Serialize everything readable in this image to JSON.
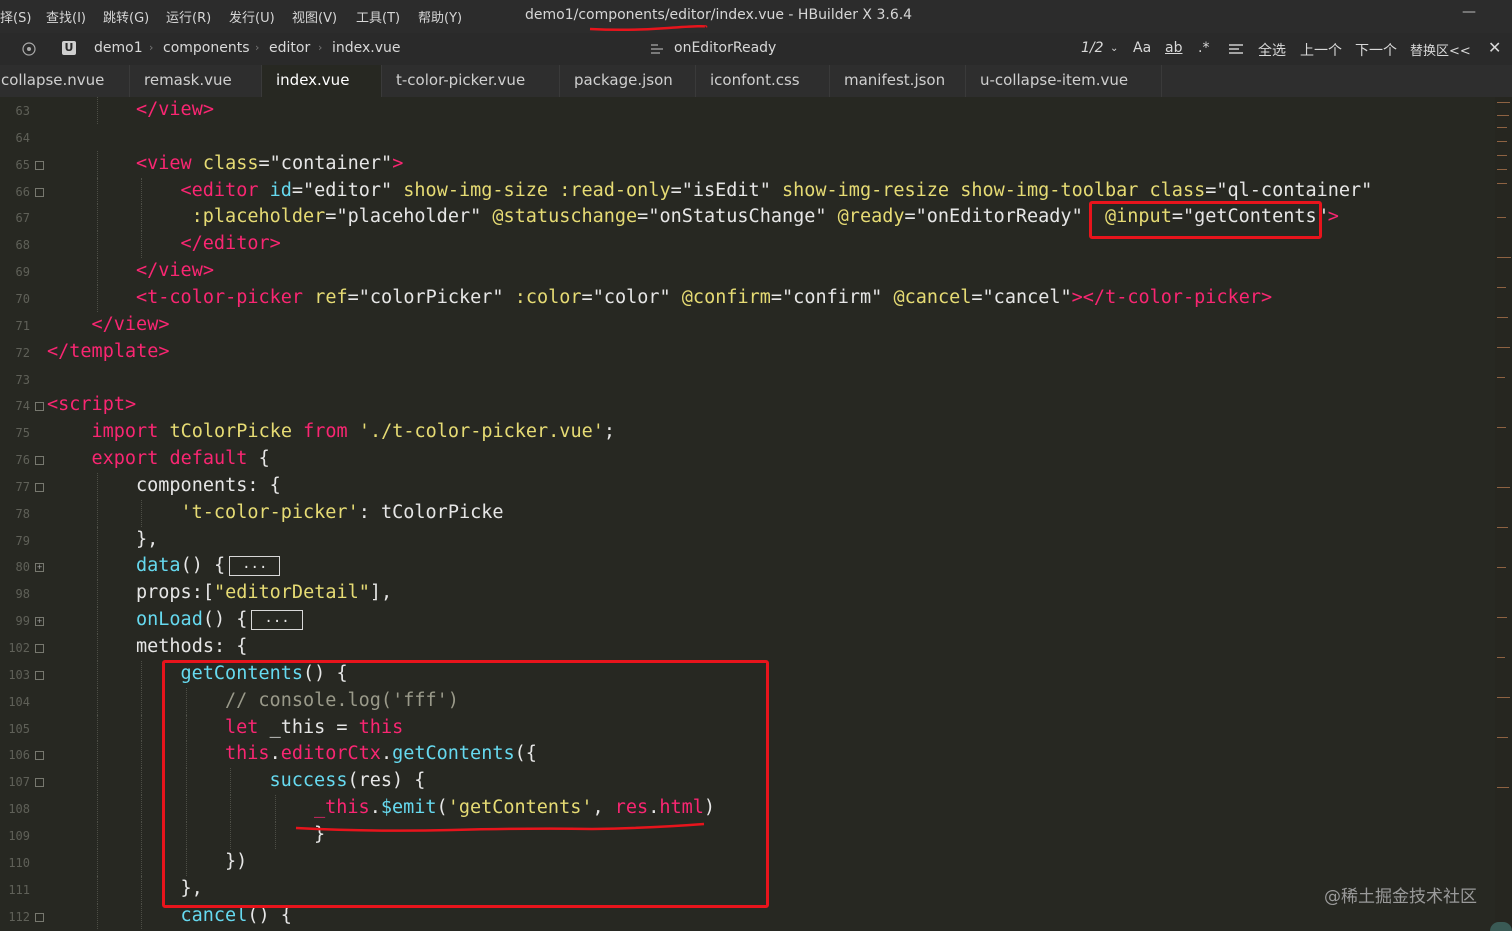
{
  "menu": [
    "择(S)",
    "查找(I)",
    "跳转(G)",
    "运行(R)",
    "发行(U)",
    "视图(V)",
    "工具(T)",
    "帮助(Y)"
  ],
  "window_title": "demo1/components/editor/index.vue - HBuilder X 3.6.4",
  "breadcrumb": [
    "demo1",
    "components",
    "editor",
    "index.vue"
  ],
  "outline_symbol": "onEditorReady",
  "search": {
    "match_count": "1/2",
    "case_label": "Aa",
    "word_label": "ab",
    "regex_label": ".*",
    "select_all": "全选",
    "prev": "上一个",
    "next": "下一个",
    "replace_toggle": "替换区<<"
  },
  "tabs": [
    "collapse.nvue",
    "remask.vue",
    "index.vue",
    "t-color-picker.vue",
    "package.json",
    "iconfont.css",
    "manifest.json",
    "u-collapse-item.vue"
  ],
  "active_tab": "index.vue",
  "code_lines": [
    {
      "ln": "63",
      "fold": "",
      "indent": 2,
      "tokens": [
        [
          "t-tag",
          "</view>"
        ]
      ]
    },
    {
      "ln": "64",
      "fold": "",
      "indent": 0,
      "tokens": []
    },
    {
      "ln": "65",
      "fold": "-",
      "indent": 2,
      "tokens": [
        [
          "t-tag",
          "<view "
        ],
        [
          "t-attr",
          "class"
        ],
        [
          "t-plain",
          "="
        ],
        [
          "t-str",
          "\"container\""
        ],
        [
          "t-tag",
          ">"
        ]
      ]
    },
    {
      "ln": "66",
      "fold": "-",
      "indent": 3,
      "tokens": [
        [
          "t-tag",
          "<editor "
        ],
        [
          "t-id",
          "id"
        ],
        [
          "t-plain",
          "="
        ],
        [
          "t-str",
          "\"editor\" "
        ],
        [
          "t-attr",
          "show-img-size :read-only"
        ],
        [
          "t-plain",
          "="
        ],
        [
          "t-str",
          "\"isEdit\" "
        ],
        [
          "t-attr",
          "show-img-resize show-img-toolbar class"
        ],
        [
          "t-plain",
          "="
        ],
        [
          "t-str",
          "\"ql-container\""
        ]
      ]
    },
    {
      "ln": "67",
      "fold": "",
      "indent": 3,
      "tokens": [
        [
          "t-attr",
          " :placeholder"
        ],
        [
          "t-plain",
          "="
        ],
        [
          "t-str",
          "\"placeholder\" "
        ],
        [
          "t-attr",
          "@statuschange"
        ],
        [
          "t-plain",
          "="
        ],
        [
          "t-str",
          "\"onStatusChange\" "
        ],
        [
          "t-attr",
          "@ready"
        ],
        [
          "t-plain",
          "="
        ],
        [
          "t-str",
          "\"onEditorReady\"  "
        ],
        [
          "t-attr",
          "@input"
        ],
        [
          "t-plain",
          "="
        ],
        [
          "t-str",
          "\"getContents\""
        ],
        [
          "t-tag",
          ">"
        ]
      ]
    },
    {
      "ln": "68",
      "fold": "",
      "indent": 3,
      "tokens": [
        [
          "t-tag",
          "</editor>"
        ]
      ]
    },
    {
      "ln": "69",
      "fold": "",
      "indent": 2,
      "tokens": [
        [
          "t-tag",
          "</view>"
        ]
      ]
    },
    {
      "ln": "70",
      "fold": "",
      "indent": 2,
      "tokens": [
        [
          "t-tag",
          "<t-color-picker "
        ],
        [
          "t-attr",
          "ref"
        ],
        [
          "t-plain",
          "="
        ],
        [
          "t-str",
          "\"colorPicker\" "
        ],
        [
          "t-attr",
          ":color"
        ],
        [
          "t-plain",
          "="
        ],
        [
          "t-str",
          "\"color\" "
        ],
        [
          "t-attr",
          "@confirm"
        ],
        [
          "t-plain",
          "="
        ],
        [
          "t-str",
          "\"confirm\" "
        ],
        [
          "t-attr",
          "@cancel"
        ],
        [
          "t-plain",
          "="
        ],
        [
          "t-str",
          "\"cancel\""
        ],
        [
          "t-tag",
          "></t-color-picker>"
        ]
      ]
    },
    {
      "ln": "71",
      "fold": "",
      "indent": 1,
      "tokens": [
        [
          "t-tag",
          "</view>"
        ]
      ]
    },
    {
      "ln": "72",
      "fold": "",
      "indent": 0,
      "tokens": [
        [
          "t-tag",
          "</template>"
        ]
      ]
    },
    {
      "ln": "73",
      "fold": "",
      "indent": 0,
      "tokens": []
    },
    {
      "ln": "74",
      "fold": "-",
      "indent": 0,
      "tokens": [
        [
          "t-tag",
          "<script>"
        ]
      ]
    },
    {
      "ln": "75",
      "fold": "",
      "indent": 1,
      "tokens": [
        [
          "t-kw",
          "import "
        ],
        [
          "t-attr",
          "tColorPicke "
        ],
        [
          "t-kw",
          "from "
        ],
        [
          "t-attr",
          "'./t-color-picker.vue'"
        ],
        [
          "t-plain",
          ";"
        ]
      ]
    },
    {
      "ln": "76",
      "fold": "-",
      "indent": 1,
      "tokens": [
        [
          "t-kw",
          "export default "
        ],
        [
          "t-plain",
          "{"
        ]
      ]
    },
    {
      "ln": "77",
      "fold": "-",
      "indent": 2,
      "tokens": [
        [
          "t-plain",
          "components: {"
        ]
      ]
    },
    {
      "ln": "78",
      "fold": "",
      "indent": 3,
      "tokens": [
        [
          "t-attr",
          "'t-color-picker'"
        ],
        [
          "t-plain",
          ": tColorPicke"
        ]
      ]
    },
    {
      "ln": "79",
      "fold": "",
      "indent": 2,
      "tokens": [
        [
          "t-plain",
          "},"
        ]
      ]
    },
    {
      "ln": "80",
      "fold": "+",
      "indent": 2,
      "tokens": [
        [
          "t-fn",
          "data"
        ],
        [
          "t-plain",
          "() {"
        ]
      ],
      "folded": "..."
    },
    {
      "ln": "98",
      "fold": "",
      "indent": 2,
      "tokens": [
        [
          "t-plain",
          "props:["
        ],
        [
          "t-attr",
          "\"editorDetail\""
        ],
        [
          "t-plain",
          "],"
        ]
      ]
    },
    {
      "ln": "99",
      "fold": "+",
      "indent": 2,
      "tokens": [
        [
          "t-fn",
          "onLoad"
        ],
        [
          "t-plain",
          "() {"
        ]
      ],
      "folded": "..."
    },
    {
      "ln": "102",
      "fold": "-",
      "indent": 2,
      "tokens": [
        [
          "t-plain",
          "methods: {"
        ]
      ]
    },
    {
      "ln": "103",
      "fold": "-",
      "indent": 3,
      "tokens": [
        [
          "t-fn",
          "getContents"
        ],
        [
          "t-plain",
          "() {"
        ]
      ]
    },
    {
      "ln": "104",
      "fold": "",
      "indent": 4,
      "tokens": [
        [
          "t-cmt",
          "// console.log('fff')"
        ]
      ]
    },
    {
      "ln": "105",
      "fold": "",
      "indent": 4,
      "tokens": [
        [
          "t-kw",
          "let "
        ],
        [
          "t-plain",
          "_this = "
        ],
        [
          "t-kw",
          "this"
        ]
      ]
    },
    {
      "ln": "106",
      "fold": "-",
      "indent": 4,
      "tokens": [
        [
          "t-kw",
          "this"
        ],
        [
          "t-plain",
          "."
        ],
        [
          "t-kw",
          "editorCtx"
        ],
        [
          "t-plain",
          "."
        ],
        [
          "t-fn",
          "getContents"
        ],
        [
          "t-plain",
          "({"
        ]
      ]
    },
    {
      "ln": "107",
      "fold": "-",
      "indent": 5,
      "tokens": [
        [
          "t-fn",
          "success"
        ],
        [
          "t-plain",
          "(res) {"
        ]
      ]
    },
    {
      "ln": "108",
      "fold": "",
      "indent": 6,
      "tokens": [
        [
          "t-kw",
          "_this"
        ],
        [
          "t-plain",
          "."
        ],
        [
          "t-fn",
          "$emit"
        ],
        [
          "t-plain",
          "("
        ],
        [
          "t-attr",
          "'getContents'"
        ],
        [
          "t-plain",
          ", "
        ],
        [
          "t-kw",
          "res"
        ],
        [
          "t-plain",
          "."
        ],
        [
          "t-kw",
          "html"
        ],
        [
          "t-plain",
          ")"
        ]
      ]
    },
    {
      "ln": "109",
      "fold": "",
      "indent": 6,
      "tokens": [
        [
          "t-plain",
          "}"
        ]
      ]
    },
    {
      "ln": "110",
      "fold": "",
      "indent": 4,
      "tokens": [
        [
          "t-plain",
          "})"
        ]
      ]
    },
    {
      "ln": "111",
      "fold": "",
      "indent": 3,
      "tokens": [
        [
          "t-plain",
          "},"
        ]
      ]
    },
    {
      "ln": "112",
      "fold": "-",
      "indent": 3,
      "tokens": [
        [
          "t-fn",
          "cancel"
        ],
        [
          "t-plain",
          "() {"
        ]
      ]
    }
  ],
  "watermark": "@稀土掘金技术社区",
  "colors": {
    "background": "#272822",
    "tag": "#f92672",
    "attribute": "#e6db74",
    "function": "#66d9ef",
    "annotation_red": "#e8141c"
  }
}
